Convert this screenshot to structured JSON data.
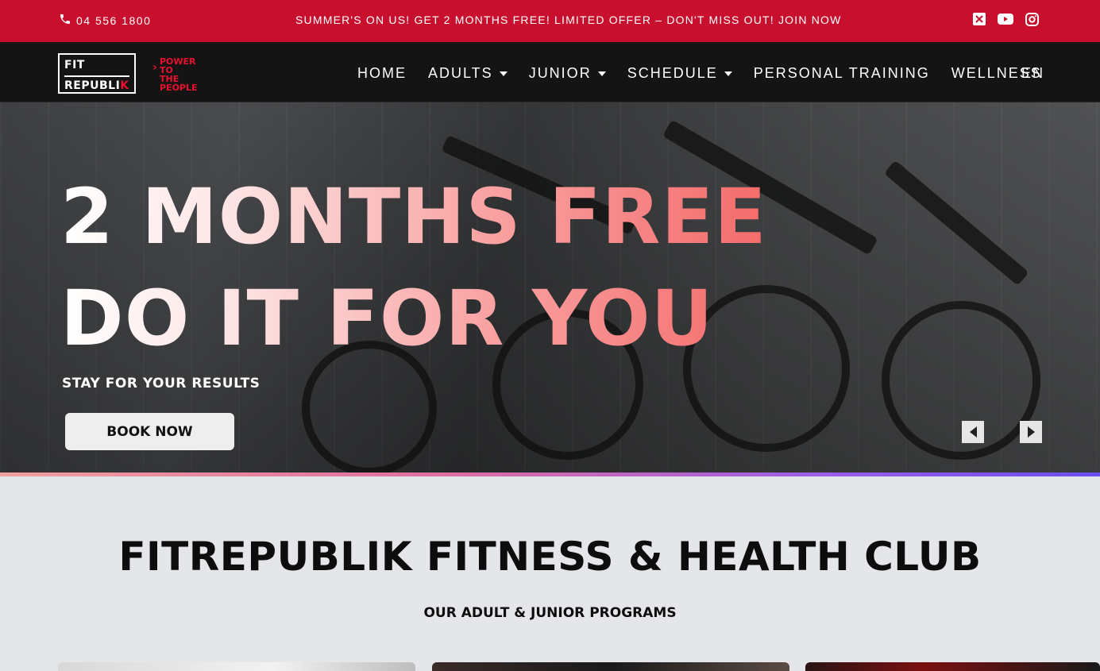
{
  "topbar": {
    "phone": "04 556  1800",
    "promo": "SUMMER'S ON US! GET 2 MONTHS FREE! LIMITED OFFER – DON'T MISS OUT! JOIN NOW",
    "social_icons": [
      "x-icon",
      "youtube-icon",
      "instagram-icon"
    ],
    "bg_color": "#c8102e"
  },
  "brand": {
    "logo_line1": "FIT",
    "logo_line2a": "REPUBLI",
    "logo_line2b": "K",
    "tagline": [
      "POWER",
      "TO",
      "THE",
      "PEOPLE"
    ]
  },
  "nav": {
    "items": [
      {
        "label": "HOME"
      },
      {
        "label": "ADULTS"
      },
      {
        "label": "JUNIOR"
      },
      {
        "label": "SCHEDULE"
      },
      {
        "label": "PERSONAL TRAINING"
      },
      {
        "label": "WELLNESS"
      }
    ],
    "language": "EN"
  },
  "hero": {
    "headline_line1": "2 MONTHS FREE",
    "headline_line2": "DO IT FOR YOU",
    "subtitle": "STAY FOR YOUR RESULTS",
    "cta": "BOOK NOW"
  },
  "programs": {
    "title": "FITREPUBLIK FITNESS & HEALTH CLUB",
    "subtitle": "OUR ADULT & JUNIOR PROGRAMS"
  }
}
